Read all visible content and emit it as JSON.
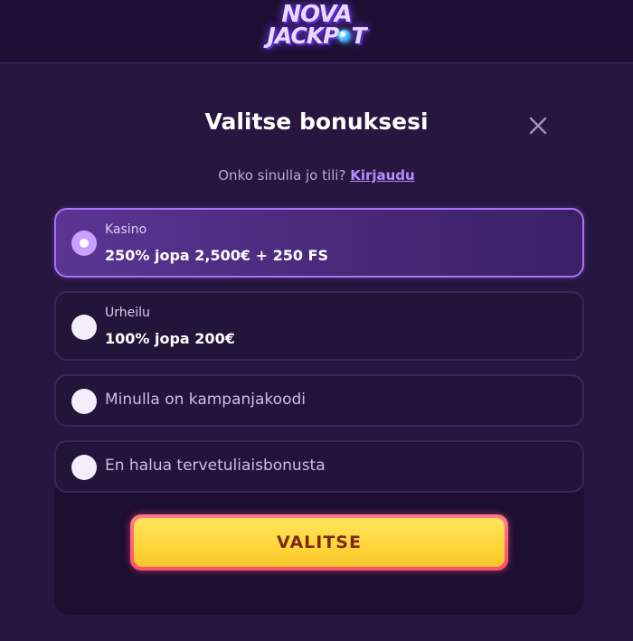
{
  "header": {
    "logo_line1": "NOVA",
    "logo_line2a": "JACKP",
    "logo_line2b": "T"
  },
  "modal": {
    "title": "Valitse bonuksesi",
    "login_prompt": "Onko sinulla jo tili?",
    "login_link": "Kirjaudu",
    "options": [
      {
        "category": "Kasino",
        "value": "250% jopa 2,500€ + 250 FS",
        "selected": true
      },
      {
        "category": "Urheilu",
        "value": "100% jopa 200€",
        "selected": false
      },
      {
        "label": "Minulla on kampanjakoodi",
        "selected": false
      },
      {
        "label": "En halua tervetuliaisbonusta",
        "selected": false
      }
    ],
    "cta_label": "VALITSE"
  },
  "colors": {
    "background": "#261640",
    "accent": "#a873f5",
    "cta_yellow": "#ffd63a",
    "cta_border": "#ff4d6d"
  },
  "icons": {
    "close": "close-icon",
    "radio_selected": "radio-selected-icon",
    "radio_empty": "radio-empty-icon"
  }
}
